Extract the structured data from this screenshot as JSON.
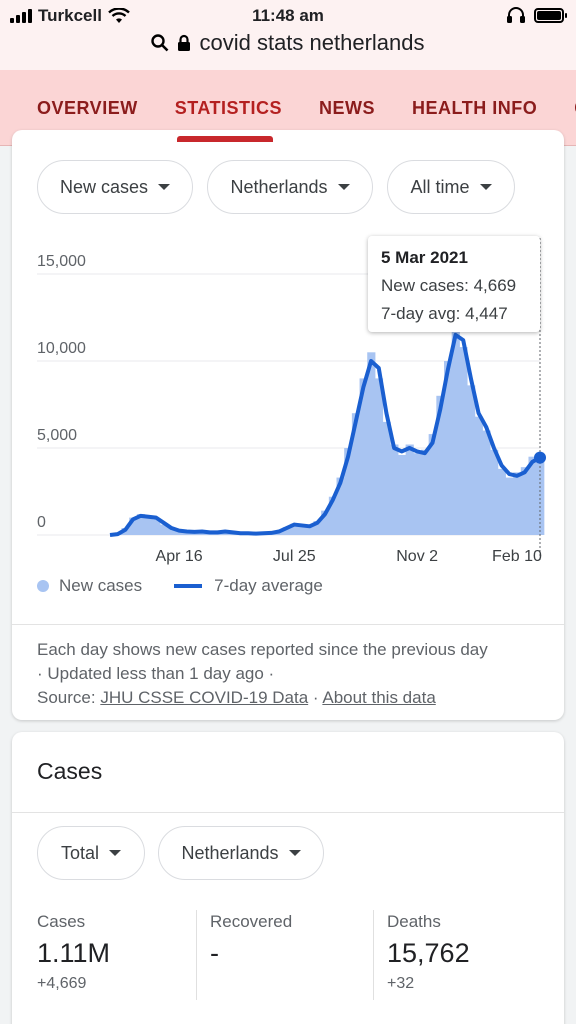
{
  "status": {
    "carrier": "Turkcell",
    "time": "11:48 am"
  },
  "url": {
    "query": "covid stats netherlands"
  },
  "tabs": [
    {
      "label": "OVERVIEW"
    },
    {
      "label": "STATISTICS"
    },
    {
      "label": "NEWS"
    },
    {
      "label": "HEALTH INFO"
    },
    {
      "label": "C"
    }
  ],
  "filters": {
    "metric": "New cases",
    "region": "Netherlands",
    "range": "All time"
  },
  "tooltip": {
    "date": "5 Mar 2021",
    "new_cases": "New cases: 4,669",
    "avg": "7-day avg: 4,447"
  },
  "legend": {
    "bars": "New cases",
    "line": "7-day average"
  },
  "footer": {
    "line1": "Each day shows new cases reported since the previous day",
    "updated": "Updated less than 1 day ago",
    "source_label": "Source:",
    "source_link": "JHU CSSE COVID-19 Data",
    "about_link": "About this data"
  },
  "cases_card": {
    "title": "Cases",
    "filter_mode": "Total",
    "filter_region": "Netherlands",
    "stats": [
      {
        "label": "Cases",
        "value": "1.11M",
        "delta": "+4,669"
      },
      {
        "label": "Recovered",
        "value": "-",
        "delta": ""
      },
      {
        "label": "Deaths",
        "value": "15,762",
        "delta": "+32"
      }
    ]
  },
  "colors": {
    "accent": "#1a5fd0",
    "bars": "#a8c4f2",
    "tab_bg": "#fbd5d5",
    "tab_text": "#8b1c1c"
  },
  "chart_data": {
    "type": "area",
    "x_ticks": [
      "Apr 16",
      "Jul 25",
      "Nov 2",
      "Feb 10"
    ],
    "y_ticks": [
      "0",
      "5,000",
      "10,000",
      "15,000"
    ],
    "ylim": [
      0,
      15000
    ],
    "series": [
      {
        "name": "New cases",
        "kind": "bars"
      },
      {
        "name": "7-day average",
        "kind": "line"
      }
    ],
    "line_values": [
      0,
      50,
      300,
      900,
      1100,
      1050,
      1000,
      700,
      400,
      250,
      200,
      180,
      200,
      150,
      150,
      200,
      150,
      100,
      100,
      80,
      100,
      120,
      200,
      400,
      600,
      550,
      500,
      700,
      1200,
      2000,
      3000,
      4500,
      6500,
      8500,
      10000,
      9600,
      7000,
      5000,
      4800,
      5000,
      4800,
      4700,
      5300,
      7200,
      9500,
      11500,
      11200,
      9000,
      7000,
      6200,
      5000,
      4000,
      3500,
      3400,
      3600,
      4200,
      4447
    ],
    "bar_values": [
      0,
      80,
      400,
      1000,
      1200,
      1000,
      900,
      600,
      400,
      250,
      200,
      150,
      200,
      150,
      160,
      180,
      150,
      120,
      100,
      90,
      110,
      140,
      250,
      450,
      650,
      550,
      520,
      800,
      1400,
      2200,
      3300,
      5000,
      7000,
      9000,
      10500,
      9000,
      6500,
      5200,
      4600,
      5200,
      4700,
      4900,
      5800,
      8000,
      10000,
      12000,
      10800,
      8600,
      6800,
      6000,
      4900,
      3800,
      3300,
      3600,
      3900,
      4500,
      4669
    ],
    "grid": true,
    "legend_position": "bottom-left"
  }
}
